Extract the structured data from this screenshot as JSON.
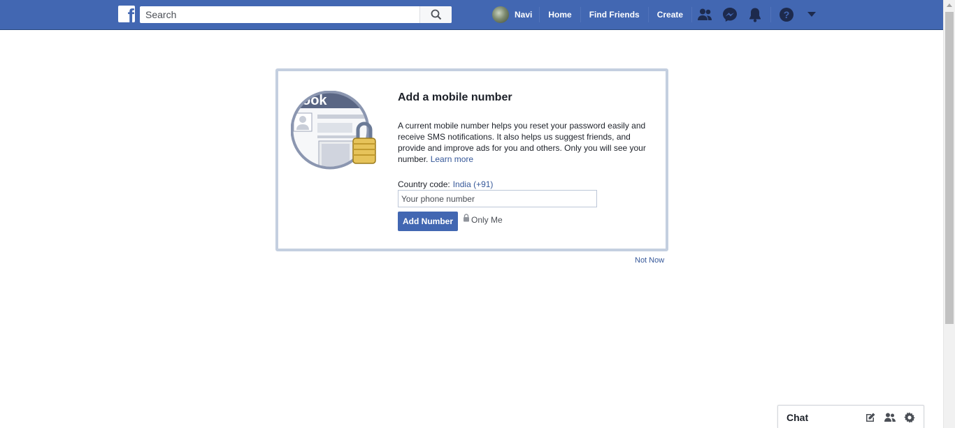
{
  "topbar": {
    "logo_letter": "f",
    "search_placeholder": "Search",
    "profile_name": "Navi",
    "links": [
      "Home",
      "Find Friends",
      "Create"
    ],
    "brand_color": "#4267b2"
  },
  "card": {
    "title": "Add a mobile number",
    "description": "A current mobile number helps you reset your password easily and receive SMS notifications. It also helps us suggest friends, and provide and improve ads for you and others. Only you will see your number.",
    "learn_more": "Learn more",
    "illustration_text": "ook",
    "country_code_label": "Country code:",
    "country_code_value": "India (+91)",
    "phone_placeholder": "Your phone number",
    "add_button": "Add Number",
    "privacy_label": "Only Me"
  },
  "not_now": "Not Now",
  "chat": {
    "label": "Chat"
  }
}
